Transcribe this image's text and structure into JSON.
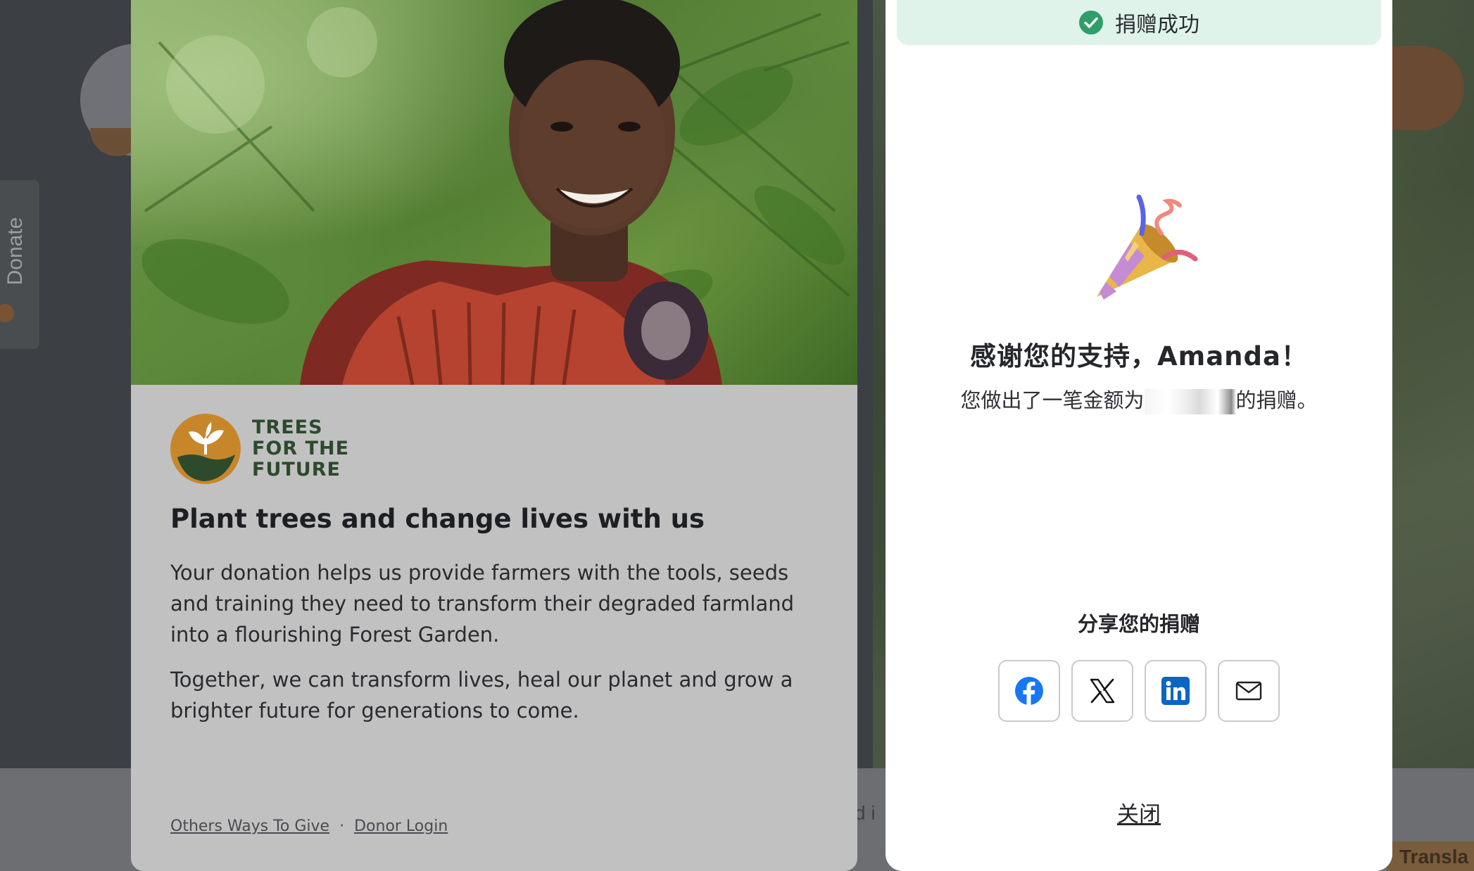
{
  "background": {
    "donate_tab_label": "Donate",
    "footer_text_fragment": "d i",
    "translate_fragment": "Transla"
  },
  "left_card": {
    "logo": {
      "line1": "TREES",
      "line2": "FOR THE",
      "line3": "FUTURE"
    },
    "title": "Plant trees and change lives with us",
    "paragraph1": "Your donation helps us provide farmers with the tools, seeds and training they need to transform their degraded farmland into a flourishing Forest Garden.",
    "paragraph2": "Together, we can transform lives, heal our planet and grow a brighter future for generations to come.",
    "links": {
      "other_ways": "Others Ways To Give",
      "separator": "·",
      "donor_login": "Donor Login"
    }
  },
  "modal": {
    "success_banner": "捐赠成功",
    "thanks_title": "感谢您的支持，Amanda！",
    "thanks_sub_before": "您做出了一笔金额为",
    "thanks_sub_after": "的捐赠。",
    "share_title": "分享您的捐赠",
    "share_buttons": [
      {
        "name": "facebook",
        "icon": "facebook-icon"
      },
      {
        "name": "x",
        "icon": "x-icon"
      },
      {
        "name": "linkedin",
        "icon": "linkedin-icon"
      },
      {
        "name": "email",
        "icon": "mail-icon"
      }
    ],
    "close_label": "关闭"
  },
  "colors": {
    "success_bg": "#dff3ea",
    "success_check": "#2f9e6a",
    "facebook": "#1877f2",
    "linkedin": "#0a66c2",
    "brand_green": "#2d4a2c",
    "brand_orange": "#c8862b"
  }
}
